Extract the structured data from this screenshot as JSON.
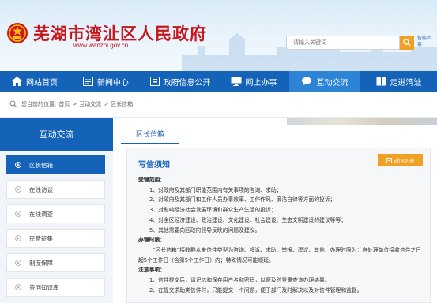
{
  "header": {
    "site_title": "芜湖市湾沚区人民政府",
    "site_url": "www.wanzhi.gov.cn",
    "search_placeholder": "请输入关键词",
    "advanced_search": "智能检索"
  },
  "nav": {
    "items": [
      {
        "label": "网站首页",
        "icon": "home-icon"
      },
      {
        "label": "新闻中心",
        "icon": "news-icon"
      },
      {
        "label": "政府信息公开",
        "icon": "document-icon"
      },
      {
        "label": "网上办事",
        "icon": "monitor-icon"
      },
      {
        "label": "互动交流",
        "icon": "chat-icon"
      },
      {
        "label": "走进湾沚",
        "icon": "book-icon"
      }
    ],
    "active_index": 4
  },
  "breadcrumb": {
    "prefix": "您当前的位置:",
    "items": [
      "首页",
      "互动交流",
      "区长信箱"
    ],
    "separator": ">"
  },
  "sidebar": {
    "title": "互动交流",
    "items": [
      "区长信箱",
      "在线访谈",
      "在线调查",
      "民意征集",
      "制度保障",
      "答问知识库"
    ],
    "active_index": 0
  },
  "main": {
    "tab": "区长信箱",
    "panel_title": "写信须知",
    "return_button": "返回列表",
    "sections": {
      "scope_heading": "受理范围：",
      "scope_items": [
        "1、对政府及其部门职能范围内有关事项的咨询、求助；",
        "2、对政府及其部门和工作人员办事效率、工作作风、廉洁自律等方面的投诉；",
        "3、对影响经济社会发展环境和群众生产生活的投诉；",
        "4、对全区经济建设、政治建设、文化建设、社会建设、生态文明建设的建议等等；",
        "5、其他需要向区政府领导反映的问题及建议。"
      ],
      "deadline_heading": "办理时限：",
      "deadline_text": "“区长信箱”接收群众来信件类型为咨询、投诉、求助、举报、建议、其他，办理时限为：自处理单位接收信件之日起5个工作日（含第5个工作日）内；特殊情况可能顺延。",
      "notes_heading": "注意事项：",
      "notes_items": [
        "1、信件提交后，请记忆和保存用户名和密码，以便及时登录查询办理结果。",
        "2、在提交求助类信件时，只能提交一个问题，便于部门及时解决以及对信件管理和监督。"
      ]
    }
  },
  "colors": {
    "primary_blue": "#1563b8",
    "title_red": "#c8161d",
    "accent_orange": "#f0a023"
  }
}
